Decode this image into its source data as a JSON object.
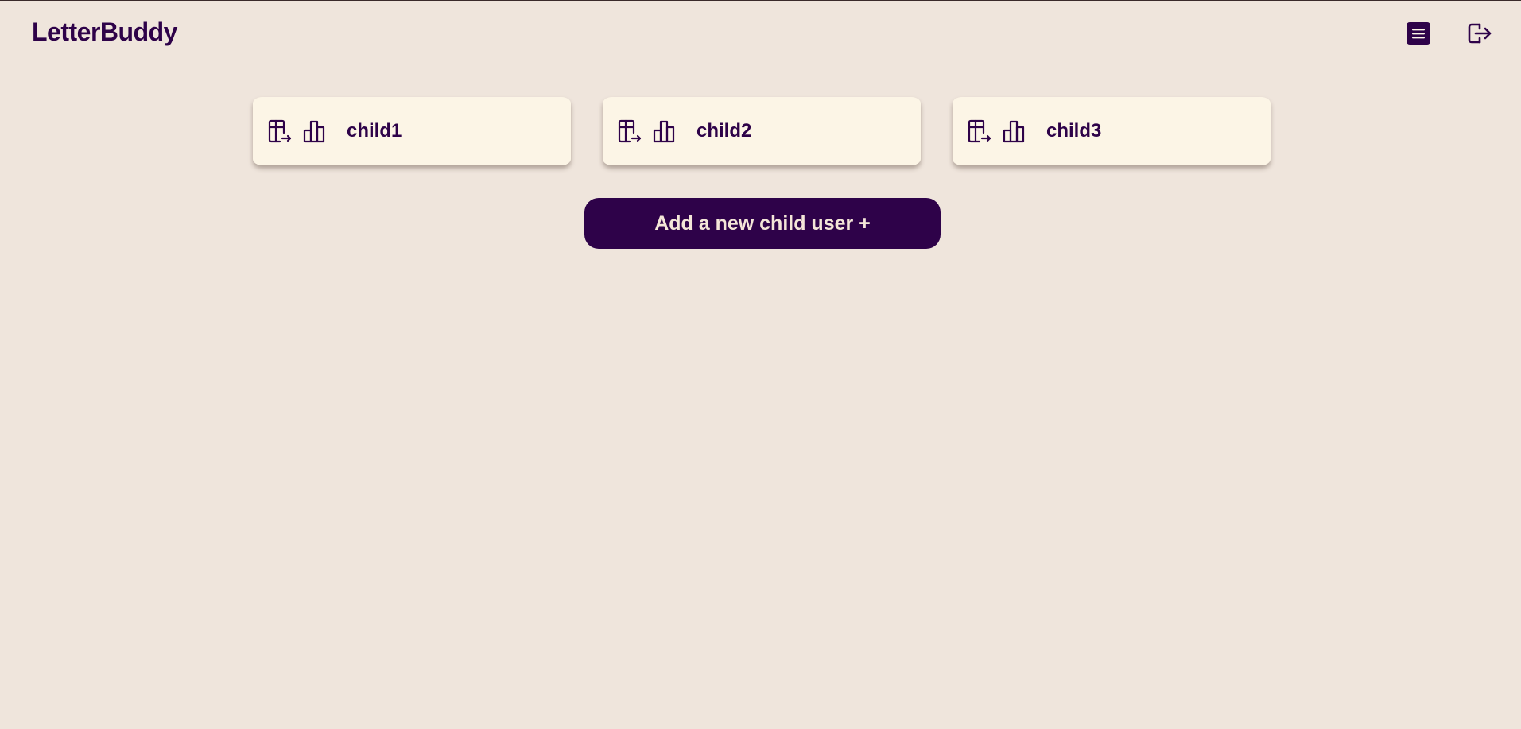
{
  "header": {
    "brand": "LetterBuddy",
    "menu_icon": "list-menu-icon",
    "logout_icon": "logout-icon"
  },
  "children": [
    {
      "name": "child1",
      "icons": [
        "table-export-icon",
        "bar-chart-icon"
      ]
    },
    {
      "name": "child2",
      "icons": [
        "table-export-icon",
        "bar-chart-icon"
      ]
    },
    {
      "name": "child3",
      "icons": [
        "table-export-icon",
        "bar-chart-icon"
      ]
    }
  ],
  "actions": {
    "add_child_label": "Add a new child user +"
  },
  "colors": {
    "background": "#efe5dc",
    "card": "#fcf5e6",
    "primary": "#2e0249",
    "button_text": "#f4e6d8"
  }
}
